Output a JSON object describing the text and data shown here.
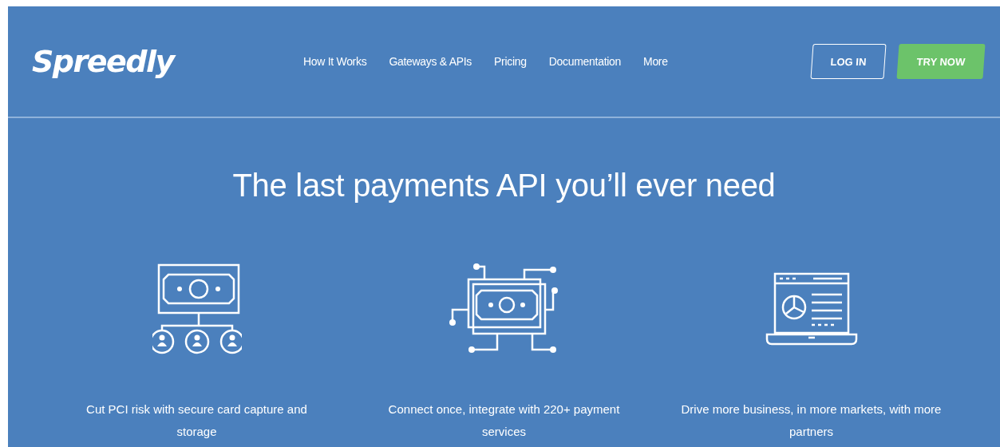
{
  "header": {
    "logo": "Spreedly",
    "nav": [
      "How It Works",
      "Gateways & APIs",
      "Pricing",
      "Documentation",
      "More"
    ],
    "login": "LOG IN",
    "cta": "TRY NOW"
  },
  "hero": {
    "headline": "The last payments API you’ll ever need",
    "features": [
      {
        "kind": "bill-network",
        "caption": "Cut PCI risk with secure card capture and storage"
      },
      {
        "kind": "bill-circuit",
        "caption": "Connect once, integrate with 220+ payment services"
      },
      {
        "kind": "laptop-chart",
        "caption": "Drive more business, in more markets, with more partners"
      }
    ]
  }
}
